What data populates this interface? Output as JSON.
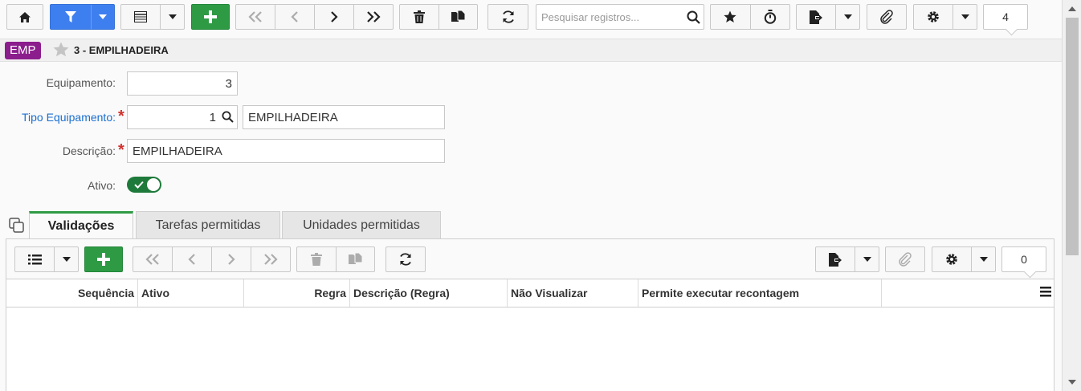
{
  "toolbar": {
    "search_placeholder": "Pesquisar registros...",
    "record_count": "4"
  },
  "record": {
    "badge": "EMP",
    "title": "3 - EMPILHADEIRA"
  },
  "form": {
    "equipamento_label": "Equipamento:",
    "equipamento_value": "3",
    "tipo_label": "Tipo Equipamento:",
    "tipo_code": "1",
    "tipo_desc": "EMPILHADEIRA",
    "descricao_label": "Descrição:",
    "descricao_value": "EMPILHADEIRA",
    "ativo_label": "Ativo:"
  },
  "tabs": [
    {
      "label": "Validações"
    },
    {
      "label": "Tarefas permitidas"
    },
    {
      "label": "Unidades permitidas"
    }
  ],
  "subtoolbar": {
    "record_count": "0"
  },
  "grid": {
    "columns": [
      {
        "label": "Sequência"
      },
      {
        "label": "Ativo"
      },
      {
        "label": "Regra"
      },
      {
        "label": "Descrição (Regra)"
      },
      {
        "label": "Não Visualizar"
      },
      {
        "label": "Permite executar recontagem"
      }
    ]
  },
  "colors": {
    "primary": "#3e7ff0",
    "success": "#2e9b44",
    "badge": "#8b1d8c",
    "link": "#1a6fd0",
    "required": "#d0312d"
  }
}
